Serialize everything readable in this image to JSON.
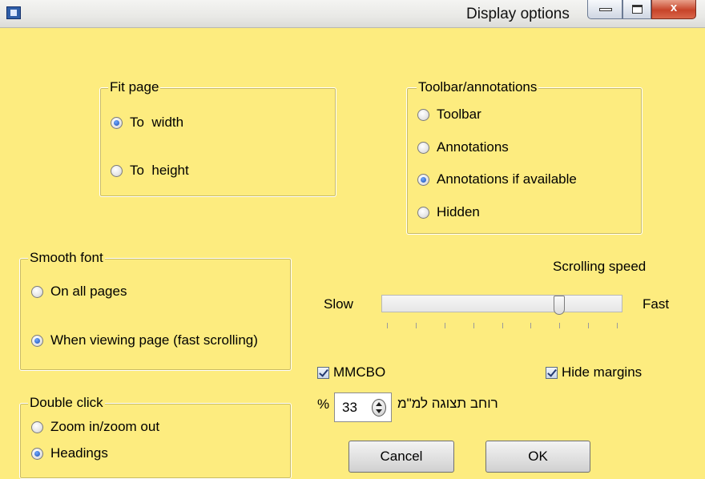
{
  "window": {
    "title": "Display options",
    "icon": "app-icon",
    "controls": {
      "minimize": "minimize-icon",
      "maximize": "maximize-icon",
      "close": "x"
    }
  },
  "fit_page": {
    "legend": "Fit page",
    "options": [
      {
        "label": "To  width",
        "selected": true
      },
      {
        "label": "To  height",
        "selected": false
      }
    ]
  },
  "toolbar_annotations": {
    "legend": "Toolbar/annotations",
    "options": [
      {
        "label": "Toolbar",
        "selected": false
      },
      {
        "label": "Annotations",
        "selected": false
      },
      {
        "label": "Annotations if available",
        "selected": true
      },
      {
        "label": "Hidden",
        "selected": false
      }
    ]
  },
  "smooth_font": {
    "legend": "Smooth font",
    "options": [
      {
        "label": "On all pages",
        "selected": false
      },
      {
        "label": "When viewing page (fast scrolling)",
        "selected": true
      }
    ]
  },
  "double_click": {
    "legend": "Double click",
    "options": [
      {
        "label": "Zoom in/zoom out",
        "selected": false
      },
      {
        "label": "Headings",
        "selected": true
      }
    ]
  },
  "scrolling": {
    "label": "Scrolling speed",
    "slow_label": "Slow",
    "fast_label": "Fast",
    "position_fraction": 0.75
  },
  "checkboxes": {
    "mmcbo": {
      "label": "MMCBO",
      "checked": true
    },
    "hide_margins": {
      "label": "Hide margins",
      "checked": true
    }
  },
  "display_width": {
    "percent_sign": "%",
    "value": "33",
    "label": "רוחב תצוגה למ\"מ"
  },
  "buttons": {
    "cancel": "Cancel",
    "ok": "OK"
  },
  "colors": {
    "background": "#fdec7f",
    "close_button": "#c7442a"
  }
}
